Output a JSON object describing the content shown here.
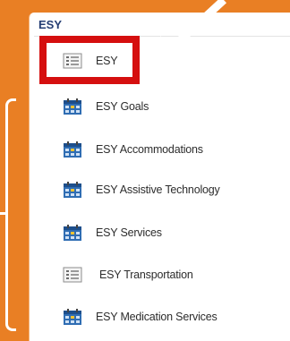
{
  "panel": {
    "title": "ESY",
    "items": [
      {
        "label": "ESY",
        "icon": "list-icon"
      },
      {
        "label": "ESY Goals",
        "icon": "calendar-icon"
      },
      {
        "label": "ESY Accommodations",
        "icon": "calendar-icon"
      },
      {
        "label": "ESY Assistive Technology",
        "icon": "calendar-icon"
      },
      {
        "label": "ESY Services",
        "icon": "calendar-icon"
      },
      {
        "label": "ESY Transportation",
        "icon": "list-icon"
      },
      {
        "label": "ESY Medication Services",
        "icon": "calendar-icon"
      }
    ]
  },
  "colors": {
    "background": "#e97f24",
    "highlight": "#d50f0f",
    "title": "#243d73"
  }
}
